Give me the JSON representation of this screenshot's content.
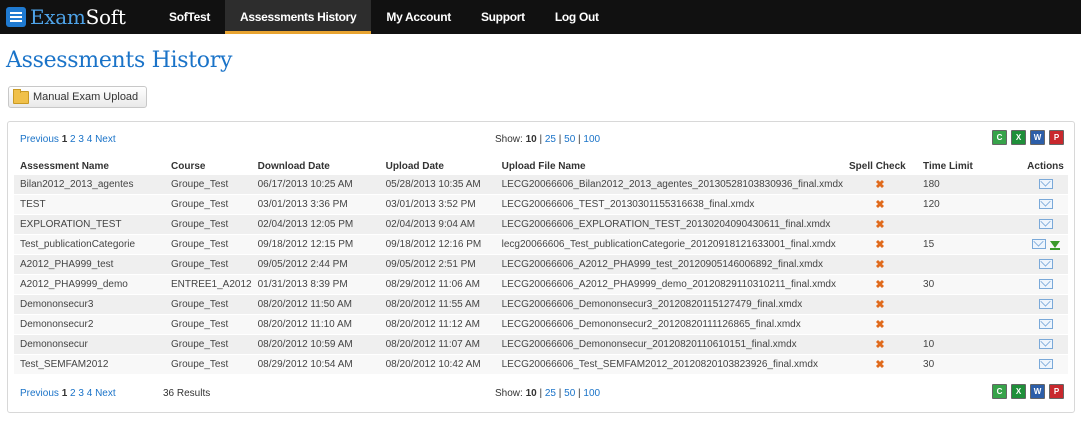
{
  "brand": {
    "part1": "Exam",
    "part2": "Soft"
  },
  "nav": [
    {
      "label": "SofTest",
      "active": false
    },
    {
      "label": "Assessments History",
      "active": true
    },
    {
      "label": "My Account",
      "active": false
    },
    {
      "label": "Support",
      "active": false
    },
    {
      "label": "Log Out",
      "active": false
    }
  ],
  "page_title": "Assessments History",
  "upload_button": "Manual Exam Upload",
  "pager": {
    "previous": "Previous",
    "pages": [
      "1",
      "2",
      "3",
      "4"
    ],
    "current": "1",
    "next": "Next"
  },
  "results_text": "36 Results",
  "show": {
    "label": "Show:",
    "options": [
      "10",
      "25",
      "50",
      "100"
    ],
    "selected": "10"
  },
  "exports": [
    "csv",
    "xls",
    "doc",
    "pdf"
  ],
  "columns": [
    "Assessment Name",
    "Course",
    "Download Date",
    "Upload Date",
    "Upload File Name",
    "Spell Check",
    "Time Limit",
    "Actions"
  ],
  "rows": [
    {
      "name": "Bilan2012_2013_agentes",
      "course": "Groupe_Test",
      "download": "06/17/2013 10:25 AM",
      "upload": "05/28/2013 10:35 AM",
      "file": "LECG20066606_Bilan2012_2013_agentes_20130528103830936_final.xmdx",
      "spell": "✖",
      "time": "180",
      "download_action": false
    },
    {
      "name": "TEST",
      "course": "Groupe_Test",
      "download": "03/01/2013 3:36 PM",
      "upload": "03/01/2013 3:52 PM",
      "file": "LECG20066606_TEST_20130301155316638_final.xmdx",
      "spell": "✖",
      "time": "120",
      "download_action": false
    },
    {
      "name": "EXPLORATION_TEST",
      "course": "Groupe_Test",
      "download": "02/04/2013 12:05 PM",
      "upload": "02/04/2013 9:04 AM",
      "file": "LECG20066606_EXPLORATION_TEST_20130204090430611_final.xmdx",
      "spell": "✖",
      "time": "",
      "download_action": false
    },
    {
      "name": "Test_publicationCategorie",
      "course": "Groupe_Test",
      "download": "09/18/2012 12:15 PM",
      "upload": "09/18/2012 12:16 PM",
      "file": "lecg20066606_Test_publicationCategorie_20120918121633001_final.xmdx",
      "spell": "✖",
      "time": "15",
      "download_action": true
    },
    {
      "name": "A2012_PHA999_test",
      "course": "Groupe_Test",
      "download": "09/05/2012 2:44 PM",
      "upload": "09/05/2012 2:51 PM",
      "file": "LECG20066606_A2012_PHA999_test_20120905146006892_final.xmdx",
      "spell": "✖",
      "time": "",
      "download_action": false
    },
    {
      "name": "A2012_PHA9999_demo",
      "course": "ENTREE1_A2012",
      "download": "01/31/2013 8:39 PM",
      "upload": "08/29/2012 11:06 AM",
      "file": "LECG20066606_A2012_PHA9999_demo_20120829110310211_final.xmdx",
      "spell": "✖",
      "time": "30",
      "download_action": false
    },
    {
      "name": "Demononsecur3",
      "course": "Groupe_Test",
      "download": "08/20/2012 11:50 AM",
      "upload": "08/20/2012 11:55 AM",
      "file": "LECG20066606_Demononsecur3_20120820115127479_final.xmdx",
      "spell": "✖",
      "time": "",
      "download_action": false
    },
    {
      "name": "Demononsecur2",
      "course": "Groupe_Test",
      "download": "08/20/2012 11:10 AM",
      "upload": "08/20/2012 11:12 AM",
      "file": "LECG20066606_Demononsecur2_20120820111126865_final.xmdx",
      "spell": "✖",
      "time": "",
      "download_action": false
    },
    {
      "name": "Demononsecur",
      "course": "Groupe_Test",
      "download": "08/20/2012 10:59 AM",
      "upload": "08/20/2012 11:07 AM",
      "file": "LECG20066606_Demononsecur_20120820110610151_final.xmdx",
      "spell": "✖",
      "time": "10",
      "download_action": false
    },
    {
      "name": "Test_SEMFAM2012",
      "course": "Groupe_Test",
      "download": "08/29/2012 10:54 AM",
      "upload": "08/20/2012 10:42 AM",
      "file": "LECG20066606_Test_SEMFAM2012_20120820103823926_final.xmdx",
      "spell": "✖",
      "time": "30",
      "download_action": false
    }
  ]
}
